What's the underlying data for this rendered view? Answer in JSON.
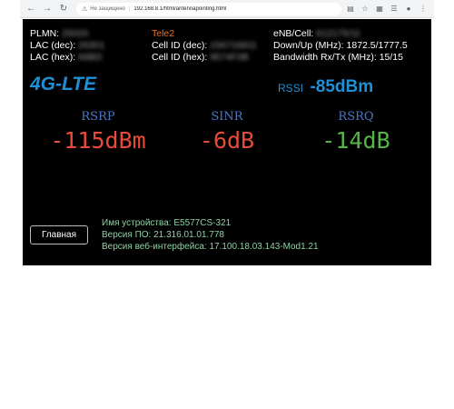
{
  "browser": {
    "back_icon": "arrow-left-icon",
    "forward_icon": "arrow-right-icon",
    "reload_icon": "reload-icon",
    "security_text": "Не защищено",
    "url": "192.168.8.1/html/antennapointing.html"
  },
  "info": {
    "plmn_label": "PLMN:",
    "plmn_value": "25020",
    "lac_dec_label": "LAC (dec):",
    "lac_dec_value": "26301",
    "lac_hex_label": "LAC (hex):",
    "lac_hex_value": "66BD",
    "operator": "Tele2",
    "cell_dec_label": "Cell ID (dec):",
    "cell_dec_value": "156716811",
    "cell_hex_label": "Cell ID (hex):",
    "cell_hex_value": "9574F0B",
    "enb_label": "eNB/Cell:",
    "enb_value": "612175/11",
    "freq_label": "Down/Up (MHz):",
    "freq_value": "1872.5/1777.5",
    "bw_label": "Bandwidth Rx/Tx (MHz):",
    "bw_value": "15/15"
  },
  "network": {
    "mode": "4G-LTE",
    "rssi_label": "RSSI",
    "rssi_value": "-85dBm"
  },
  "metrics": {
    "rsrp_label": "RSRP",
    "rsrp_value": "-115dBm",
    "sinr_label": "SINR",
    "sinr_value": "-6dB",
    "rsrq_label": "RSRQ",
    "rsrq_value": "-14dB"
  },
  "footer": {
    "home_button": "Главная",
    "device_name": "Имя устройства: E5577CS-321",
    "fw_version": "Версия ПО: 21.316.01.01.778",
    "webui_version": "Версия веб-интерфейса: 17.100.18.03.143-Mod1.21"
  },
  "colors": {
    "background": "#000000",
    "operator": "#f36f21",
    "network": "#1e90d6",
    "metric_label": "#4a77c4",
    "bad": "#e84a3b",
    "good": "#55b547",
    "device_text": "#8fd1a4"
  }
}
